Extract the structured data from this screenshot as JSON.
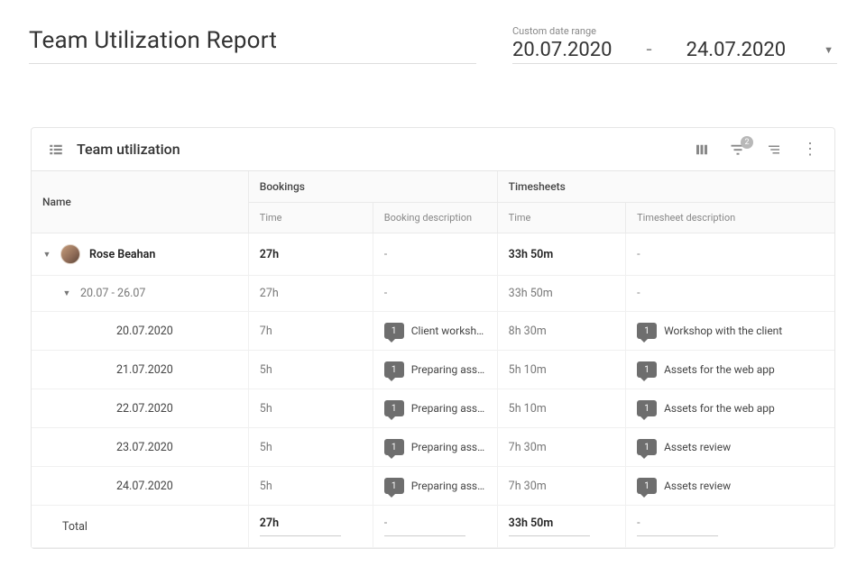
{
  "page": {
    "title": "Team Utilization Report"
  },
  "dateRange": {
    "label": "Custom date range",
    "start": "20.07.2020",
    "separator": "-",
    "end": "24.07.2020"
  },
  "card": {
    "title": "Team utilization",
    "filterBadge": "2"
  },
  "table": {
    "headers": {
      "name": "Name",
      "bookings": "Bookings",
      "timesheets": "Timesheets",
      "bookingTime": "Time",
      "bookingDesc": "Booking description",
      "timesheetTime": "Time",
      "timesheetDesc": "Timesheet description"
    },
    "rows": [
      {
        "kind": "person",
        "level": 0,
        "name": "Rose Beahan",
        "bookingTime": "27h",
        "bookingDesc": "-",
        "timesheetTime": "33h 50m",
        "timesheetDesc": "-",
        "badgeB": "",
        "badgeT": "",
        "bold": true,
        "caret": true
      },
      {
        "kind": "week",
        "level": 1,
        "name": "20.07 - 26.07",
        "bookingTime": "27h",
        "bookingDesc": "-",
        "timesheetTime": "33h 50m",
        "timesheetDesc": "-",
        "badgeB": "",
        "badgeT": "",
        "bold": false,
        "caret": true
      },
      {
        "kind": "day",
        "level": 2,
        "name": "20.07.2020",
        "bookingTime": "7h",
        "bookingDesc": "Client workshop",
        "timesheetTime": "8h 30m",
        "timesheetDesc": "Workshop with the client",
        "badgeB": "1",
        "badgeT": "1",
        "bold": false,
        "caret": false
      },
      {
        "kind": "day",
        "level": 2,
        "name": "21.07.2020",
        "bookingTime": "5h",
        "bookingDesc": "Preparing asse...",
        "timesheetTime": "5h 10m",
        "timesheetDesc": "Assets for the web app",
        "badgeB": "1",
        "badgeT": "1",
        "bold": false,
        "caret": false
      },
      {
        "kind": "day",
        "level": 2,
        "name": "22.07.2020",
        "bookingTime": "5h",
        "bookingDesc": "Preparing asse...",
        "timesheetTime": "5h 10m",
        "timesheetDesc": "Assets for the web app",
        "badgeB": "1",
        "badgeT": "1",
        "bold": false,
        "caret": false
      },
      {
        "kind": "day",
        "level": 2,
        "name": "23.07.2020",
        "bookingTime": "5h",
        "bookingDesc": "Preparing asse...",
        "timesheetTime": "7h 30m",
        "timesheetDesc": "Assets review",
        "badgeB": "1",
        "badgeT": "1",
        "bold": false,
        "caret": false
      },
      {
        "kind": "day",
        "level": 2,
        "name": "24.07.2020",
        "bookingTime": "5h",
        "bookingDesc": "Preparing asse...",
        "timesheetTime": "7h 30m",
        "timesheetDesc": "Assets review",
        "badgeB": "1",
        "badgeT": "1",
        "bold": false,
        "caret": false
      }
    ],
    "total": {
      "label": "Total",
      "bookingTime": "27h",
      "bookingDesc": "-",
      "timesheetTime": "33h 50m",
      "timesheetDesc": "-"
    }
  }
}
